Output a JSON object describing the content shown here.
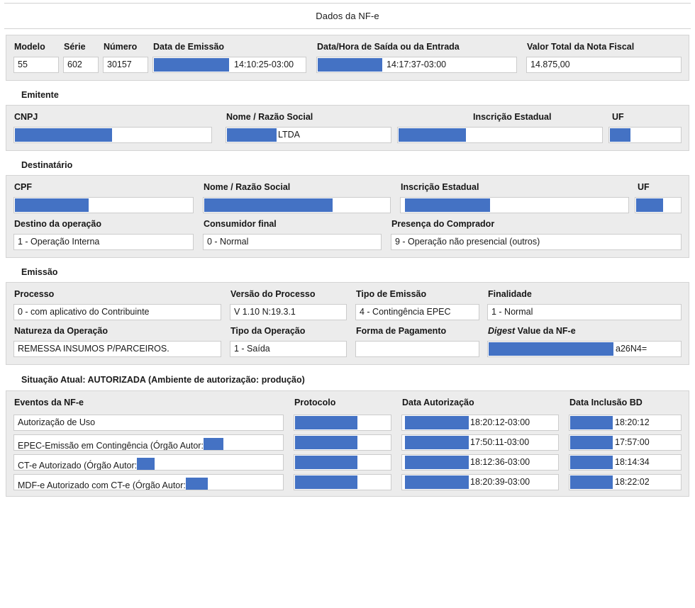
{
  "page": {
    "title": "Dados da NF-e"
  },
  "nfe_header": {
    "fields": [
      {
        "label": "Modelo",
        "value": "55",
        "redacted": false
      },
      {
        "label": "Série",
        "value": "602",
        "redacted": false
      },
      {
        "label": "Número",
        "value": "30157",
        "redacted": false
      },
      {
        "label": "Data de Emissão",
        "value": "14:10:25-03:00",
        "redacted": true
      },
      {
        "label": "Data/Hora de Saída ou da Entrada",
        "value": "14:17:37-03:00",
        "redacted": true
      },
      {
        "label": "Valor Total da Nota Fiscal",
        "value": "14.875,00",
        "redacted": false
      }
    ]
  },
  "emitente": {
    "heading": "Emitente",
    "fields": [
      {
        "label": "CNPJ",
        "value": "",
        "redacted": true
      },
      {
        "label": "Nome / Razão Social",
        "value": "LTDA",
        "redacted": true
      },
      {
        "label": "Inscrição Estadual",
        "value": "",
        "redacted": true
      },
      {
        "label": "UF",
        "value": "",
        "redacted": true
      }
    ]
  },
  "destinatario": {
    "heading": "Destinatário",
    "fields": [
      {
        "label": "CPF",
        "value": "",
        "redacted": true
      },
      {
        "label": "Nome / Razão Social",
        "value": "",
        "redacted": true
      },
      {
        "label": "Inscrição Estadual",
        "value": "",
        "redacted": true
      },
      {
        "label": "UF",
        "value": "",
        "redacted": true
      }
    ],
    "fields2": [
      {
        "label": "Destino da operação",
        "value": "1 - Operação Interna",
        "redacted": false
      },
      {
        "label": "Consumidor final",
        "value": "0 - Normal",
        "redacted": false
      },
      {
        "label": "Presença do Comprador",
        "value": "9 - Operação não presencial (outros)",
        "redacted": false
      }
    ]
  },
  "emissao": {
    "heading": "Emissão",
    "row1": [
      {
        "label": "Processo",
        "value": "0 - com aplicativo do Contribuinte",
        "redacted": false
      },
      {
        "label": "Versão do Processo",
        "value": "V 1.10 N:19.3.1",
        "redacted": false
      },
      {
        "label": "Tipo de Emissão",
        "value": "4 - Contingência EPEC",
        "redacted": false
      },
      {
        "label": "Finalidade",
        "value": "1 - Normal",
        "redacted": false
      }
    ],
    "row2": [
      {
        "label": "Natureza da Operação",
        "value": "REMESSA INSUMOS P/PARCEIROS.",
        "redacted": false
      },
      {
        "label": "Tipo da Operação",
        "value": "1 - Saída",
        "redacted": false
      },
      {
        "label": "Forma de Pagamento",
        "value": "",
        "redacted": false
      },
      {
        "label_pre": "Digest",
        "label_post": " Value da NF-e",
        "value": "a26N4=",
        "redacted": true
      }
    ]
  },
  "situacao": {
    "text": "Situação Atual: AUTORIZADA (Ambiente de autorização: produção)"
  },
  "eventos": {
    "columns": [
      "Eventos da NF-e",
      "Protocolo",
      "Data Autorização",
      "Data Inclusão BD"
    ],
    "rows": [
      {
        "evento": "Autorização de Uso",
        "evento_redact_w": 0,
        "protocolo": "",
        "data_autorizacao": "18:20:12-03:00",
        "data_inclusao": "18:20:12"
      },
      {
        "evento": "EPEC-Emissão em Contingência (Órgão Autor:",
        "evento_redact_w": 28,
        "protocolo": "",
        "data_autorizacao": "17:50:11-03:00",
        "data_inclusao": "17:57:00"
      },
      {
        "evento": "CT-e Autorizado (Órgão Autor:",
        "evento_redact_w": 25,
        "protocolo": "",
        "data_autorizacao": "18:12:36-03:00",
        "data_inclusao": "18:14:34"
      },
      {
        "evento": "MDF-e Autorizado com CT-e (Órgão Autor:",
        "evento_redact_w": 31,
        "protocolo": "",
        "data_autorizacao": "18:20:39-03:00",
        "data_inclusao": "18:22:02"
      }
    ]
  },
  "colors": {
    "redaction": "#4472C4",
    "panel_bg": "#ECECEC",
    "panel_border": "#D4D4D4",
    "field_border": "#CCCCCC",
    "page_bg": "#FFFFFF",
    "text": "#1A1A1A"
  }
}
